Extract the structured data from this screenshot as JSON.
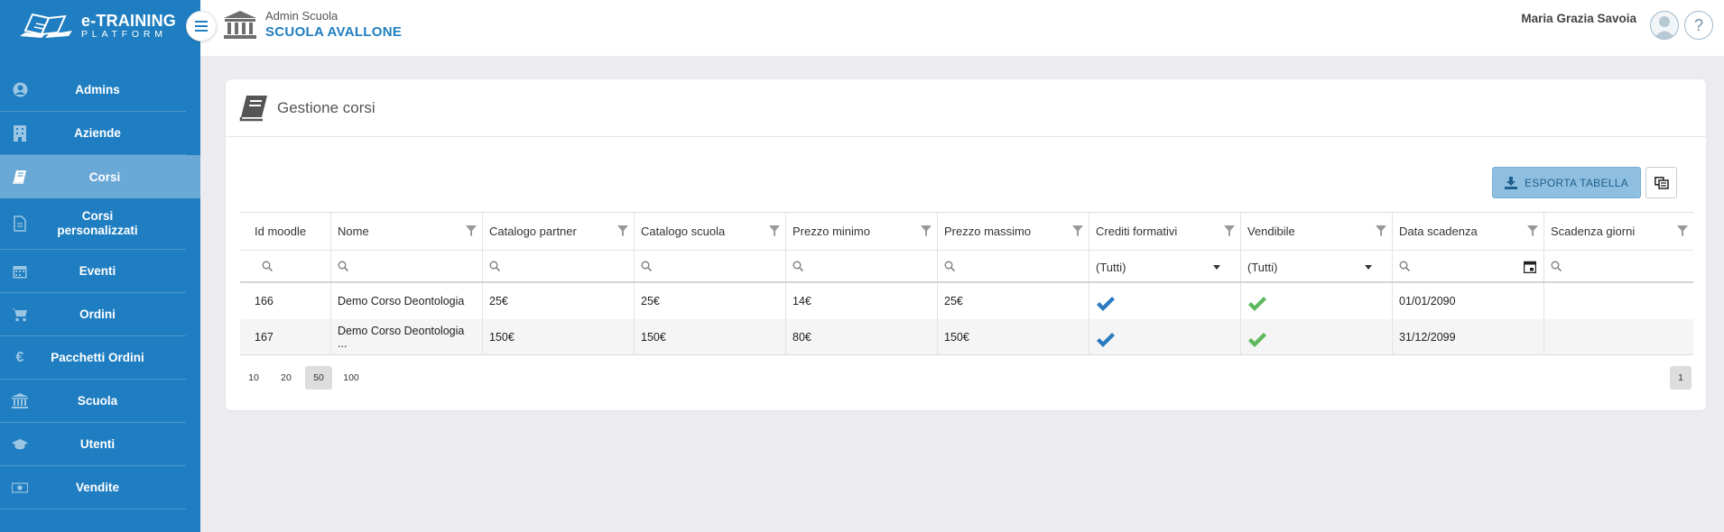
{
  "brand": {
    "name": "-TRAINING",
    "sub": "PLATFORM"
  },
  "sidebar": {
    "items": [
      {
        "label": "Admins",
        "icon": "user-circle-icon"
      },
      {
        "label": "Aziende",
        "icon": "building-icon"
      },
      {
        "label": "Corsi",
        "icon": "book-icon",
        "active": true
      },
      {
        "label": "Corsi personalizzati",
        "icon": "file-icon"
      },
      {
        "label": "Eventi",
        "icon": "calendar-icon"
      },
      {
        "label": "Ordini",
        "icon": "cart-icon"
      },
      {
        "label": "Pacchetti Ordini",
        "icon": "euro-icon"
      },
      {
        "label": "Scuola",
        "icon": "bank-icon"
      },
      {
        "label": "Utenti",
        "icon": "graduation-cap-icon"
      },
      {
        "label": "Vendite",
        "icon": "money-icon"
      }
    ]
  },
  "header": {
    "role": "Admin Scuola",
    "school": "SCUOLA AVALLONE",
    "user": "Maria Grazia Savoia",
    "help": "?"
  },
  "card": {
    "title": "Gestione corsi",
    "export_label": "ESPORTA TABELLA"
  },
  "table": {
    "columns": [
      "Id moodle",
      "Nome",
      "Catalogo partner",
      "Catalogo scuola",
      "Prezzo minimo",
      "Prezzo massimo",
      "Crediti formativi",
      "Vendibile",
      "Data scadenza",
      "Scadenza giorni"
    ],
    "select_all": "(Tutti)",
    "rows": [
      {
        "id": "166",
        "nome": "Demo Corso Deontologia",
        "partner": "25€",
        "scuola": "25€",
        "min": "14€",
        "max": "25€",
        "crediti": true,
        "vendibile": true,
        "scadenza": "01/01/2090",
        "giorni": ""
      },
      {
        "id": "167",
        "nome": "Demo Corso Deontologia ...",
        "partner": "150€",
        "scuola": "150€",
        "min": "80€",
        "max": "150€",
        "crediti": true,
        "vendibile": true,
        "scadenza": "31/12/2099",
        "giorni": ""
      }
    ]
  },
  "pager": {
    "sizes": [
      "10",
      "20",
      "50",
      "100"
    ],
    "selected_size": "50",
    "current_page": "1"
  },
  "colors": {
    "primary": "#1f7ec1",
    "active_item": "#6aa8d6",
    "check_blue": "#2a7bbf",
    "check_green": "#5cb85c"
  }
}
